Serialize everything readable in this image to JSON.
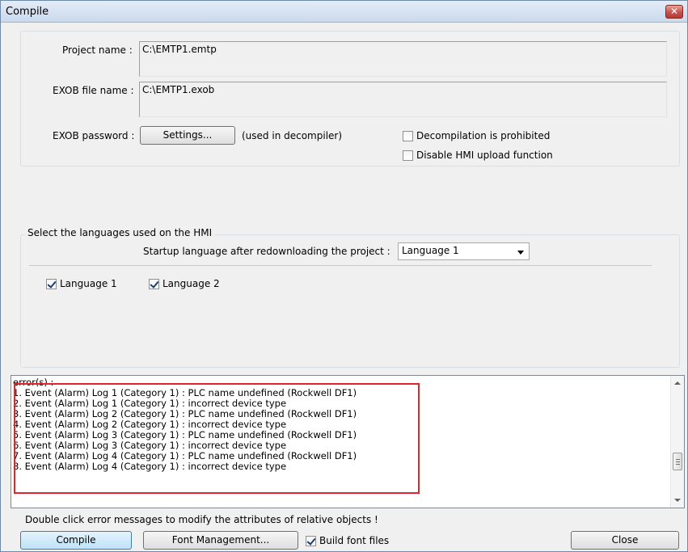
{
  "window": {
    "title": "Compile",
    "close_glyph": "✕",
    "close_icon": "close-icon"
  },
  "project": {
    "project_name_label": "Project name :",
    "project_name_value": "C:\\EMTP1.emtp",
    "exob_name_label": "EXOB file name :",
    "exob_name_value": "C:\\EMTP1.exob",
    "exob_password_label": "EXOB password :",
    "settings_button": "Settings...",
    "password_note": "(used in decompiler)",
    "decompilation_prohibited": {
      "label": "Decompilation is prohibited",
      "checked": false
    },
    "disable_upload": {
      "label": "Disable HMI upload function",
      "checked": false
    }
  },
  "languages": {
    "group_title": "Select the languages used on the HMI",
    "startup_label": "Startup language after redownloading the project :",
    "startup_selected": "Language 1",
    "items": [
      {
        "label": "Language 1",
        "checked": true
      },
      {
        "label": "Language 2",
        "checked": true
      }
    ]
  },
  "messages": {
    "lines": [
      "error(s) :",
      "1. Event (Alarm) Log 1 (Category 1)  : PLC name undefined (Rockwell DF1)",
      "2. Event (Alarm) Log 1 (Category 1) : incorrect device type",
      "3. Event (Alarm) Log 2 (Category 1)  : PLC name undefined (Rockwell DF1)",
      "4. Event (Alarm) Log 2 (Category 1) : incorrect device type",
      "5. Event (Alarm) Log 3 (Category 1)  : PLC name undefined (Rockwell DF1)",
      "6. Event (Alarm) Log 3 (Category 1) : incorrect device type",
      "7. Event (Alarm) Log 4 (Category 1)  : PLC name undefined (Rockwell DF1)",
      "8. Event (Alarm) Log 4 (Category 1) : incorrect device type"
    ],
    "highlight_color": "#e0262c"
  },
  "footer": {
    "hint": "Double click error messages to modify the attributes of relative objects !",
    "compile_button": "Compile",
    "font_management_button": "Font Management...",
    "build_font_files": {
      "label": "Build font files",
      "checked": true
    },
    "close_button": "Close"
  }
}
